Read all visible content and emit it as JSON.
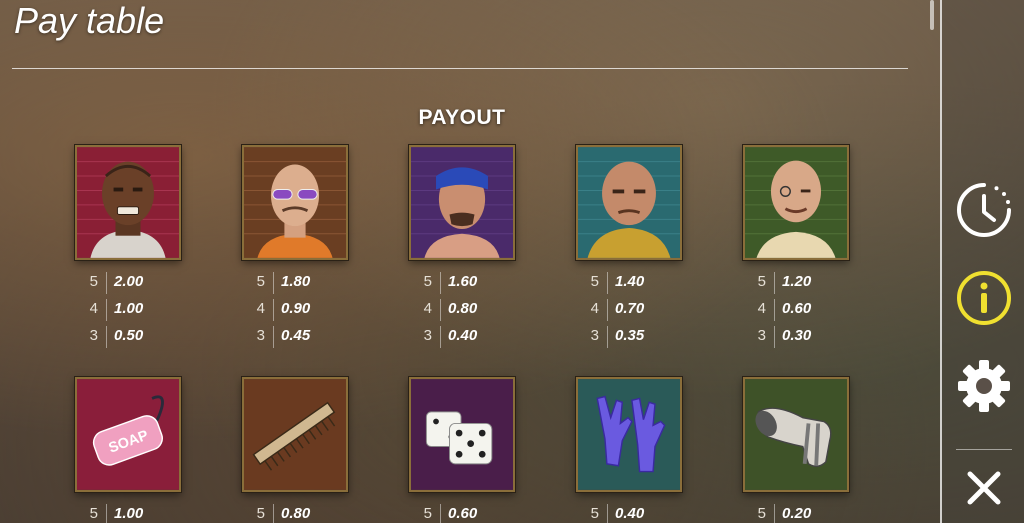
{
  "header": {
    "title": "Pay table"
  },
  "section": {
    "heading": "PAYOUT"
  },
  "symbols": [
    {
      "name": "inmate-tattooed-symbol",
      "pays": [
        {
          "count": "5",
          "value": "2.00"
        },
        {
          "count": "4",
          "value": "1.00"
        },
        {
          "count": "3",
          "value": "0.50"
        }
      ]
    },
    {
      "name": "inmate-sunglasses-symbol",
      "pays": [
        {
          "count": "5",
          "value": "1.80"
        },
        {
          "count": "4",
          "value": "0.90"
        },
        {
          "count": "3",
          "value": "0.45"
        }
      ]
    },
    {
      "name": "inmate-bandana-symbol",
      "pays": [
        {
          "count": "5",
          "value": "1.60"
        },
        {
          "count": "4",
          "value": "0.80"
        },
        {
          "count": "3",
          "value": "0.40"
        }
      ]
    },
    {
      "name": "inmate-bald-symbol",
      "pays": [
        {
          "count": "5",
          "value": "1.40"
        },
        {
          "count": "4",
          "value": "0.70"
        },
        {
          "count": "3",
          "value": "0.35"
        }
      ]
    },
    {
      "name": "inmate-old-symbol",
      "pays": [
        {
          "count": "5",
          "value": "1.20"
        },
        {
          "count": "4",
          "value": "0.60"
        },
        {
          "count": "3",
          "value": "0.30"
        }
      ]
    },
    {
      "name": "soap-symbol",
      "pays": [
        {
          "count": "5",
          "value": "1.00"
        }
      ]
    },
    {
      "name": "comb-symbol",
      "pays": [
        {
          "count": "5",
          "value": "0.80"
        }
      ]
    },
    {
      "name": "dice-symbol",
      "pays": [
        {
          "count": "5",
          "value": "0.60"
        }
      ]
    },
    {
      "name": "gloves-symbol",
      "pays": [
        {
          "count": "5",
          "value": "0.40"
        }
      ]
    },
    {
      "name": "sock-symbol",
      "pays": [
        {
          "count": "5",
          "value": "0.20"
        }
      ]
    }
  ],
  "soap_text": "SOAP",
  "sidebar": {
    "buttons": [
      {
        "name": "history-button",
        "icon": "clock-history-icon"
      },
      {
        "name": "info-button",
        "icon": "info-icon",
        "active_color": "#f0e030"
      },
      {
        "name": "settings-button",
        "icon": "gear-icon"
      },
      {
        "name": "close-button",
        "icon": "close-icon"
      }
    ]
  }
}
